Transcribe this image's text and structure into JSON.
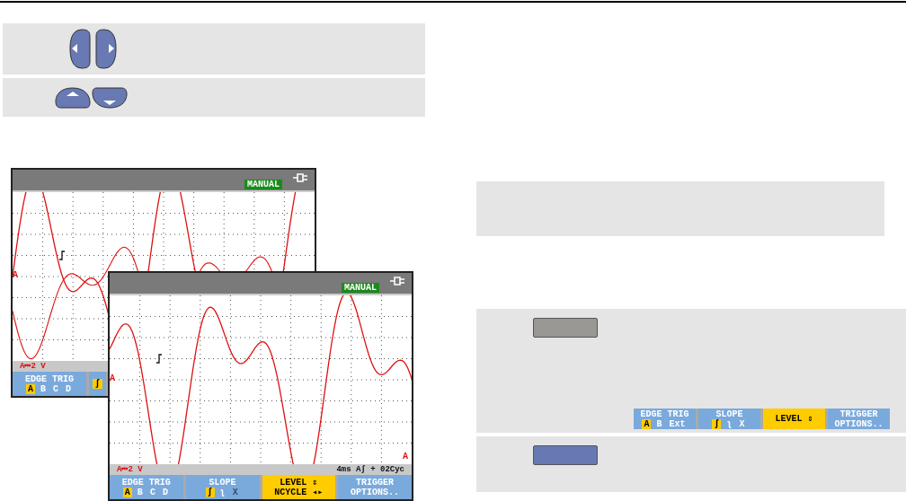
{
  "screens": [
    {
      "status": "MANUAL",
      "channel_marker": "A",
      "readout": "A⎓2 V",
      "softkeys": [
        {
          "title": "EDGE TRIG",
          "selected": false,
          "options": [
            {
              "label": "A",
              "selected": true
            },
            {
              "label": "B",
              "selected": false
            },
            {
              "label": "C",
              "selected": false
            },
            {
              "label": "D",
              "selected": false
            }
          ]
        },
        {
          "selected": false,
          "options": [
            {
              "label": "ʃ",
              "selected": true
            }
          ]
        }
      ]
    },
    {
      "status": "MANUAL",
      "channel_marker": "A",
      "end_marker": "A",
      "readout": "A⎓2 V",
      "timebase": "4ms Aʃ + 02Cyc",
      "softkeys": [
        {
          "title": "EDGE TRIG",
          "selected": false,
          "options": [
            {
              "label": "A",
              "selected": true
            },
            {
              "label": "B",
              "selected": false
            },
            {
              "label": "C",
              "selected": false
            },
            {
              "label": "D",
              "selected": false
            }
          ]
        },
        {
          "title": "SLOPE",
          "selected": false,
          "options": [
            {
              "label": "ʃ",
              "selected": true,
              "disabled": false
            },
            {
              "label": "ʅ",
              "selected": false,
              "disabled": false
            },
            {
              "label": "X",
              "selected": false,
              "disabled": true
            }
          ]
        },
        {
          "selected": true,
          "lines": [
            "LEVEL ⇕",
            "NCYCLE ◂▸"
          ]
        },
        {
          "selected": false,
          "lines": [
            "TRIGGER",
            "OPTIONS.."
          ]
        }
      ]
    }
  ],
  "menu_bar": {
    "softkeys": [
      {
        "title": "EDGE TRIG",
        "selected": false,
        "options": [
          {
            "label": "A",
            "selected": true
          },
          {
            "label": "B",
            "selected": false
          },
          {
            "label": "Ext",
            "selected": false
          }
        ]
      },
      {
        "title": "SLOPE",
        "selected": false,
        "options": [
          {
            "label": "ʃ",
            "selected": true,
            "disabled": false
          },
          {
            "label": "ʅ",
            "selected": false,
            "disabled": false
          },
          {
            "label": "X",
            "selected": false,
            "disabled": false
          }
        ]
      },
      {
        "selected": true,
        "lines": [
          "LEVEL ⇕"
        ]
      },
      {
        "selected": false,
        "lines": [
          "TRIGGER",
          "OPTIONS.."
        ]
      }
    ]
  }
}
